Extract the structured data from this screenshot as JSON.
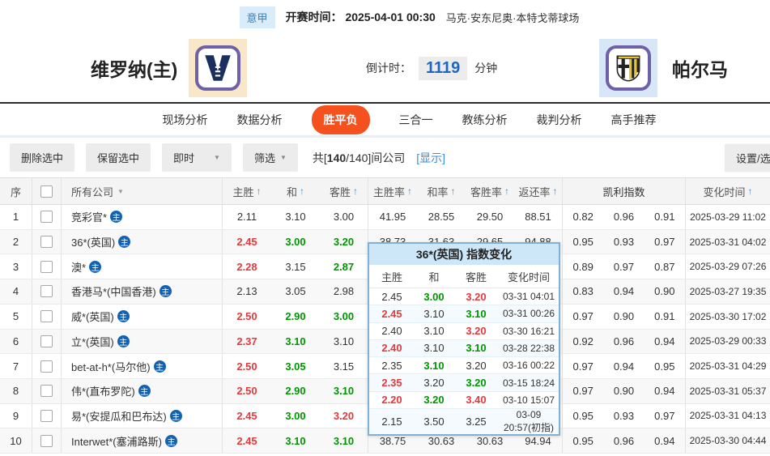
{
  "colors": {
    "accent_orange": "#f4511e",
    "odds_up_red": "#e4393c",
    "odds_down_green": "#009600",
    "link_blue": "#3a8ee6",
    "badge_blue": "#1262b3",
    "countdown_blue": "#1f66c0"
  },
  "icons": {
    "sort": "↑",
    "caret": "▼",
    "company_badge": "主"
  },
  "header": {
    "league": "意甲",
    "kickoff_label": "开赛时间：",
    "kickoff_time": "2025-04-01 00:30",
    "venue": "马克·安东尼奥·本特戈蒂球场",
    "home_team": "维罗纳(主)",
    "away_team": "帕尔马",
    "countdown_label": "倒计时：",
    "countdown_value": "1119",
    "countdown_unit": "分钟"
  },
  "tabs": [
    {
      "label": "现场分析",
      "active": false
    },
    {
      "label": "数据分析",
      "active": false
    },
    {
      "label": "胜平负",
      "active": true
    },
    {
      "label": "三合一",
      "active": false
    },
    {
      "label": "教练分析",
      "active": false
    },
    {
      "label": "裁判分析",
      "active": false
    },
    {
      "label": "高手推荐",
      "active": false
    }
  ],
  "toolbar": {
    "delete_btn": "删除选中",
    "keep_btn": "保留选中",
    "instant_dropdown": "即时",
    "filter_dropdown": "筛选",
    "count_prefix": "共[",
    "count_bold": "140",
    "count_suffix": "/140]间公司",
    "show_link": "[显示]",
    "settings_btn": "设置/选择"
  },
  "table": {
    "headers": {
      "index": "序",
      "company": "所有公司",
      "home": "主胜",
      "draw": "和",
      "away": "客胜",
      "home_rate": "主胜率",
      "draw_rate": "和率",
      "away_rate": "客胜率",
      "return_rate": "返还率",
      "kelly": "凯利指数",
      "change_time": "变化时间"
    },
    "rows": [
      {
        "num": "1",
        "company": "竞彩官*",
        "odds": [
          "2.11",
          "3.10",
          "3.00"
        ],
        "odds_colors": [
          "k",
          "k",
          "k"
        ],
        "rates": [
          "41.95",
          "28.55",
          "29.50",
          "88.51"
        ],
        "kelly": [
          "0.82",
          "0.96",
          "0.91"
        ],
        "time": "2025-03-29 11:02"
      },
      {
        "num": "2",
        "company": "36*(英国)",
        "odds": [
          "2.45",
          "3.00",
          "3.20"
        ],
        "odds_colors": [
          "r",
          "g",
          "g"
        ],
        "rates": [
          "38.73",
          "31.63",
          "29.65",
          "94.88"
        ],
        "kelly": [
          "0.95",
          "0.93",
          "0.97"
        ],
        "time": "2025-03-31 04:02"
      },
      {
        "num": "3",
        "company": "澳*",
        "odds": [
          "2.28",
          "3.15",
          "2.87"
        ],
        "odds_colors": [
          "r",
          "k",
          "g"
        ],
        "rates": [
          "",
          "",
          "",
          ""
        ],
        "kelly": [
          "0.89",
          "0.97",
          "0.87"
        ],
        "time": "2025-03-29 07:26"
      },
      {
        "num": "4",
        "company": "香港马*(中国香港)",
        "odds": [
          "2.13",
          "3.05",
          "2.98"
        ],
        "odds_colors": [
          "k",
          "k",
          "k"
        ],
        "rates": [
          "",
          "",
          "",
          ""
        ],
        "kelly": [
          "0.83",
          "0.94",
          "0.90"
        ],
        "time": "2025-03-27 19:35"
      },
      {
        "num": "5",
        "company": "威*(英国)",
        "odds": [
          "2.50",
          "2.90",
          "3.00"
        ],
        "odds_colors": [
          "r",
          "g",
          "g"
        ],
        "rates": [
          "",
          "",
          "",
          ""
        ],
        "kelly": [
          "0.97",
          "0.90",
          "0.91"
        ],
        "time": "2025-03-30 17:02"
      },
      {
        "num": "6",
        "company": "立*(英国)",
        "odds": [
          "2.37",
          "3.10",
          "3.10"
        ],
        "odds_colors": [
          "r",
          "g",
          "k"
        ],
        "rates": [
          "",
          "",
          "",
          ""
        ],
        "kelly": [
          "0.92",
          "0.96",
          "0.94"
        ],
        "time": "2025-03-29 00:33"
      },
      {
        "num": "7",
        "company": "bet-at-h*(马尔他)",
        "odds": [
          "2.50",
          "3.05",
          "3.15"
        ],
        "odds_colors": [
          "r",
          "g",
          "k"
        ],
        "rates": [
          "",
          "",
          "",
          ""
        ],
        "kelly": [
          "0.97",
          "0.94",
          "0.95"
        ],
        "time": "2025-03-31 04:29"
      },
      {
        "num": "8",
        "company": "伟*(直布罗陀)",
        "odds": [
          "2.50",
          "2.90",
          "3.10"
        ],
        "odds_colors": [
          "r",
          "g",
          "g"
        ],
        "rates": [
          "",
          "",
          "",
          ""
        ],
        "kelly": [
          "0.97",
          "0.90",
          "0.94"
        ],
        "time": "2025-03-31 05:37"
      },
      {
        "num": "9",
        "company": "易*(安提瓜和巴布达)",
        "odds": [
          "2.45",
          "3.00",
          "3.20"
        ],
        "odds_colors": [
          "r",
          "g",
          "r"
        ],
        "rates": [
          "",
          "",
          "",
          ""
        ],
        "kelly": [
          "0.95",
          "0.93",
          "0.97"
        ],
        "time": "2025-03-31 04:13"
      },
      {
        "num": "10",
        "company": "Interwet*(塞浦路斯)",
        "odds": [
          "2.45",
          "3.10",
          "3.10"
        ],
        "odds_colors": [
          "r",
          "g",
          "g"
        ],
        "rates": [
          "38.75",
          "30.63",
          "30.63",
          "94.94"
        ],
        "kelly": [
          "0.95",
          "0.96",
          "0.94"
        ],
        "time": "2025-03-30 04:44"
      }
    ]
  },
  "popup": {
    "title": "36*(英国) 指数变化",
    "headers": [
      "主胜",
      "和",
      "客胜",
      "变化时间"
    ],
    "rows": [
      {
        "odds": [
          "2.45",
          "3.00",
          "3.20"
        ],
        "colors": [
          "k",
          "g",
          "r"
        ],
        "time": "03-31 04:01"
      },
      {
        "odds": [
          "2.45",
          "3.10",
          "3.10"
        ],
        "colors": [
          "r",
          "k",
          "g"
        ],
        "time": "03-31 00:26"
      },
      {
        "odds": [
          "2.40",
          "3.10",
          "3.20"
        ],
        "colors": [
          "k",
          "k",
          "r"
        ],
        "time": "03-30 16:21"
      },
      {
        "odds": [
          "2.40",
          "3.10",
          "3.10"
        ],
        "colors": [
          "r",
          "k",
          "g"
        ],
        "time": "03-28 22:38"
      },
      {
        "odds": [
          "2.35",
          "3.10",
          "3.20"
        ],
        "colors": [
          "k",
          "g",
          "k"
        ],
        "time": "03-16 00:22"
      },
      {
        "odds": [
          "2.35",
          "3.20",
          "3.20"
        ],
        "colors": [
          "r",
          "k",
          "g"
        ],
        "time": "03-15 18:24"
      },
      {
        "odds": [
          "2.20",
          "3.20",
          "3.40"
        ],
        "colors": [
          "r",
          "g",
          "r"
        ],
        "time": "03-10 15:07"
      },
      {
        "odds": [
          "2.15",
          "3.50",
          "3.25"
        ],
        "colors": [
          "k",
          "k",
          "k"
        ],
        "time": "03-09 20:57(初指)"
      }
    ]
  }
}
